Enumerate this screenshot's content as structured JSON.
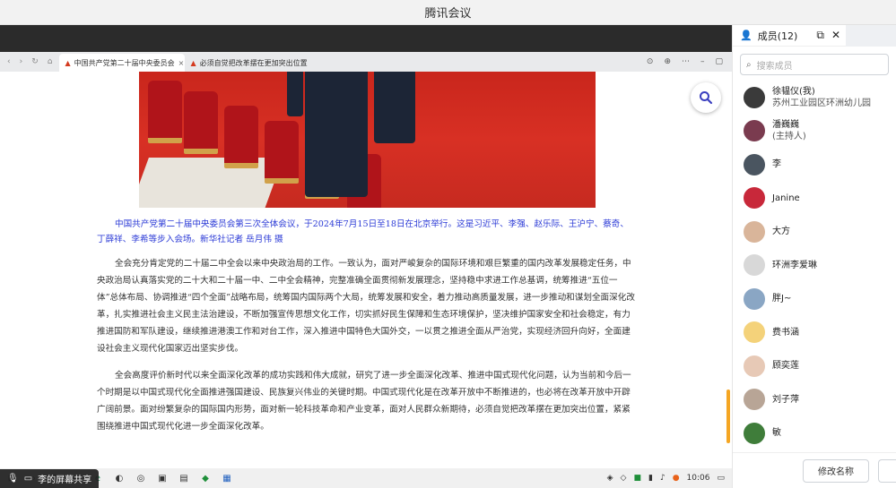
{
  "window": {
    "title": "腾讯会议"
  },
  "browser": {
    "tabs": [
      {
        "label": "中国共产党第二十届中央委员会"
      },
      {
        "label": "必须自觉把改革摆在更加突出位置"
      }
    ],
    "search_icon": "search-icon"
  },
  "article": {
    "caption": "中国共产党第二十届中央委员会第三次全体会议，于2024年7月15日至18日在北京举行。这是习近平、李强、赵乐际、王沪宁、蔡奇、丁薛祥、李希等步入会场。新华社记者 岳月伟 摄",
    "paragraph1": "全会充分肯定党的二十届二中全会以来中央政治局的工作。一致认为，面对严峻复杂的国际环境和艰巨繁重的国内改革发展稳定任务，中央政治局认真落实党的二十大和二十届一中、二中全会精神，完整准确全面贯彻新发展理念，坚持稳中求进工作总基调，统筹推进“五位一体”总体布局、协调推进“四个全面”战略布局，统筹国内国际两个大局，统筹发展和安全，着力推动高质量发展，进一步推动和谋划全面深化改革，扎实推进社会主义民主法治建设，不断加强宣传思想文化工作，切实抓好民生保障和生态环境保护，坚决维护国家安全和社会稳定，有力推进国防和军队建设，继续推进港澳工作和对台工作，深入推进中国特色大国外交，一以贯之推进全面从严治党，实现经济回升向好，全面建设社会主义现代化国家迈出坚实步伐。",
    "paragraph2": "全会高度评价新时代以来全面深化改革的成功实践和伟大成就，研究了进一步全面深化改革、推进中国式现代化问题，认为当前和今后一个时期是以中国式现代化全面推进强国建设、民族复兴伟业的关键时期。中国式现代化是在改革开放中不断推进的，也必将在改革开放中开辟广阔前景。面对纷繁复杂的国际国内形势，面对新一轮科技革命和产业变革，面对人民群众新期待，必须自觉把改革摆在更加突出位置，紧紧围绕推进中国式现代化进一步全面深化改革。"
  },
  "taskbar": {
    "time": "10:06"
  },
  "share_badge": {
    "label": "李的屏幕共享"
  },
  "panel": {
    "header": "成员(12)",
    "search_placeholder": "搜索成员",
    "members": [
      {
        "name": "徐韫仪(我)",
        "sub": "苏州工业园区环洲幼儿园",
        "color": "#3a3a3a"
      },
      {
        "name": "潘巍巍",
        "sub": "(主持人)",
        "color": "#7a3b4f"
      },
      {
        "name": "李",
        "sub": "",
        "color": "#4a5560"
      },
      {
        "name": "Janine",
        "sub": "",
        "color": "#c8283a"
      },
      {
        "name": "大方",
        "sub": "",
        "color": "#d9b59a"
      },
      {
        "name": "环洲李爱琳",
        "sub": "",
        "color": "#d8d8d8"
      },
      {
        "name": "胖J~",
        "sub": "",
        "color": "#8aa6c4"
      },
      {
        "name": "费书涵",
        "sub": "",
        "color": "#f4d27a"
      },
      {
        "name": "顾奕莲",
        "sub": "",
        "color": "#e7c9b6"
      },
      {
        "name": "刘子萍",
        "sub": "",
        "color": "#b8a596"
      },
      {
        "name": "敏",
        "sub": "",
        "color": "#3f7d3a"
      }
    ],
    "rename_label": "修改名称"
  }
}
